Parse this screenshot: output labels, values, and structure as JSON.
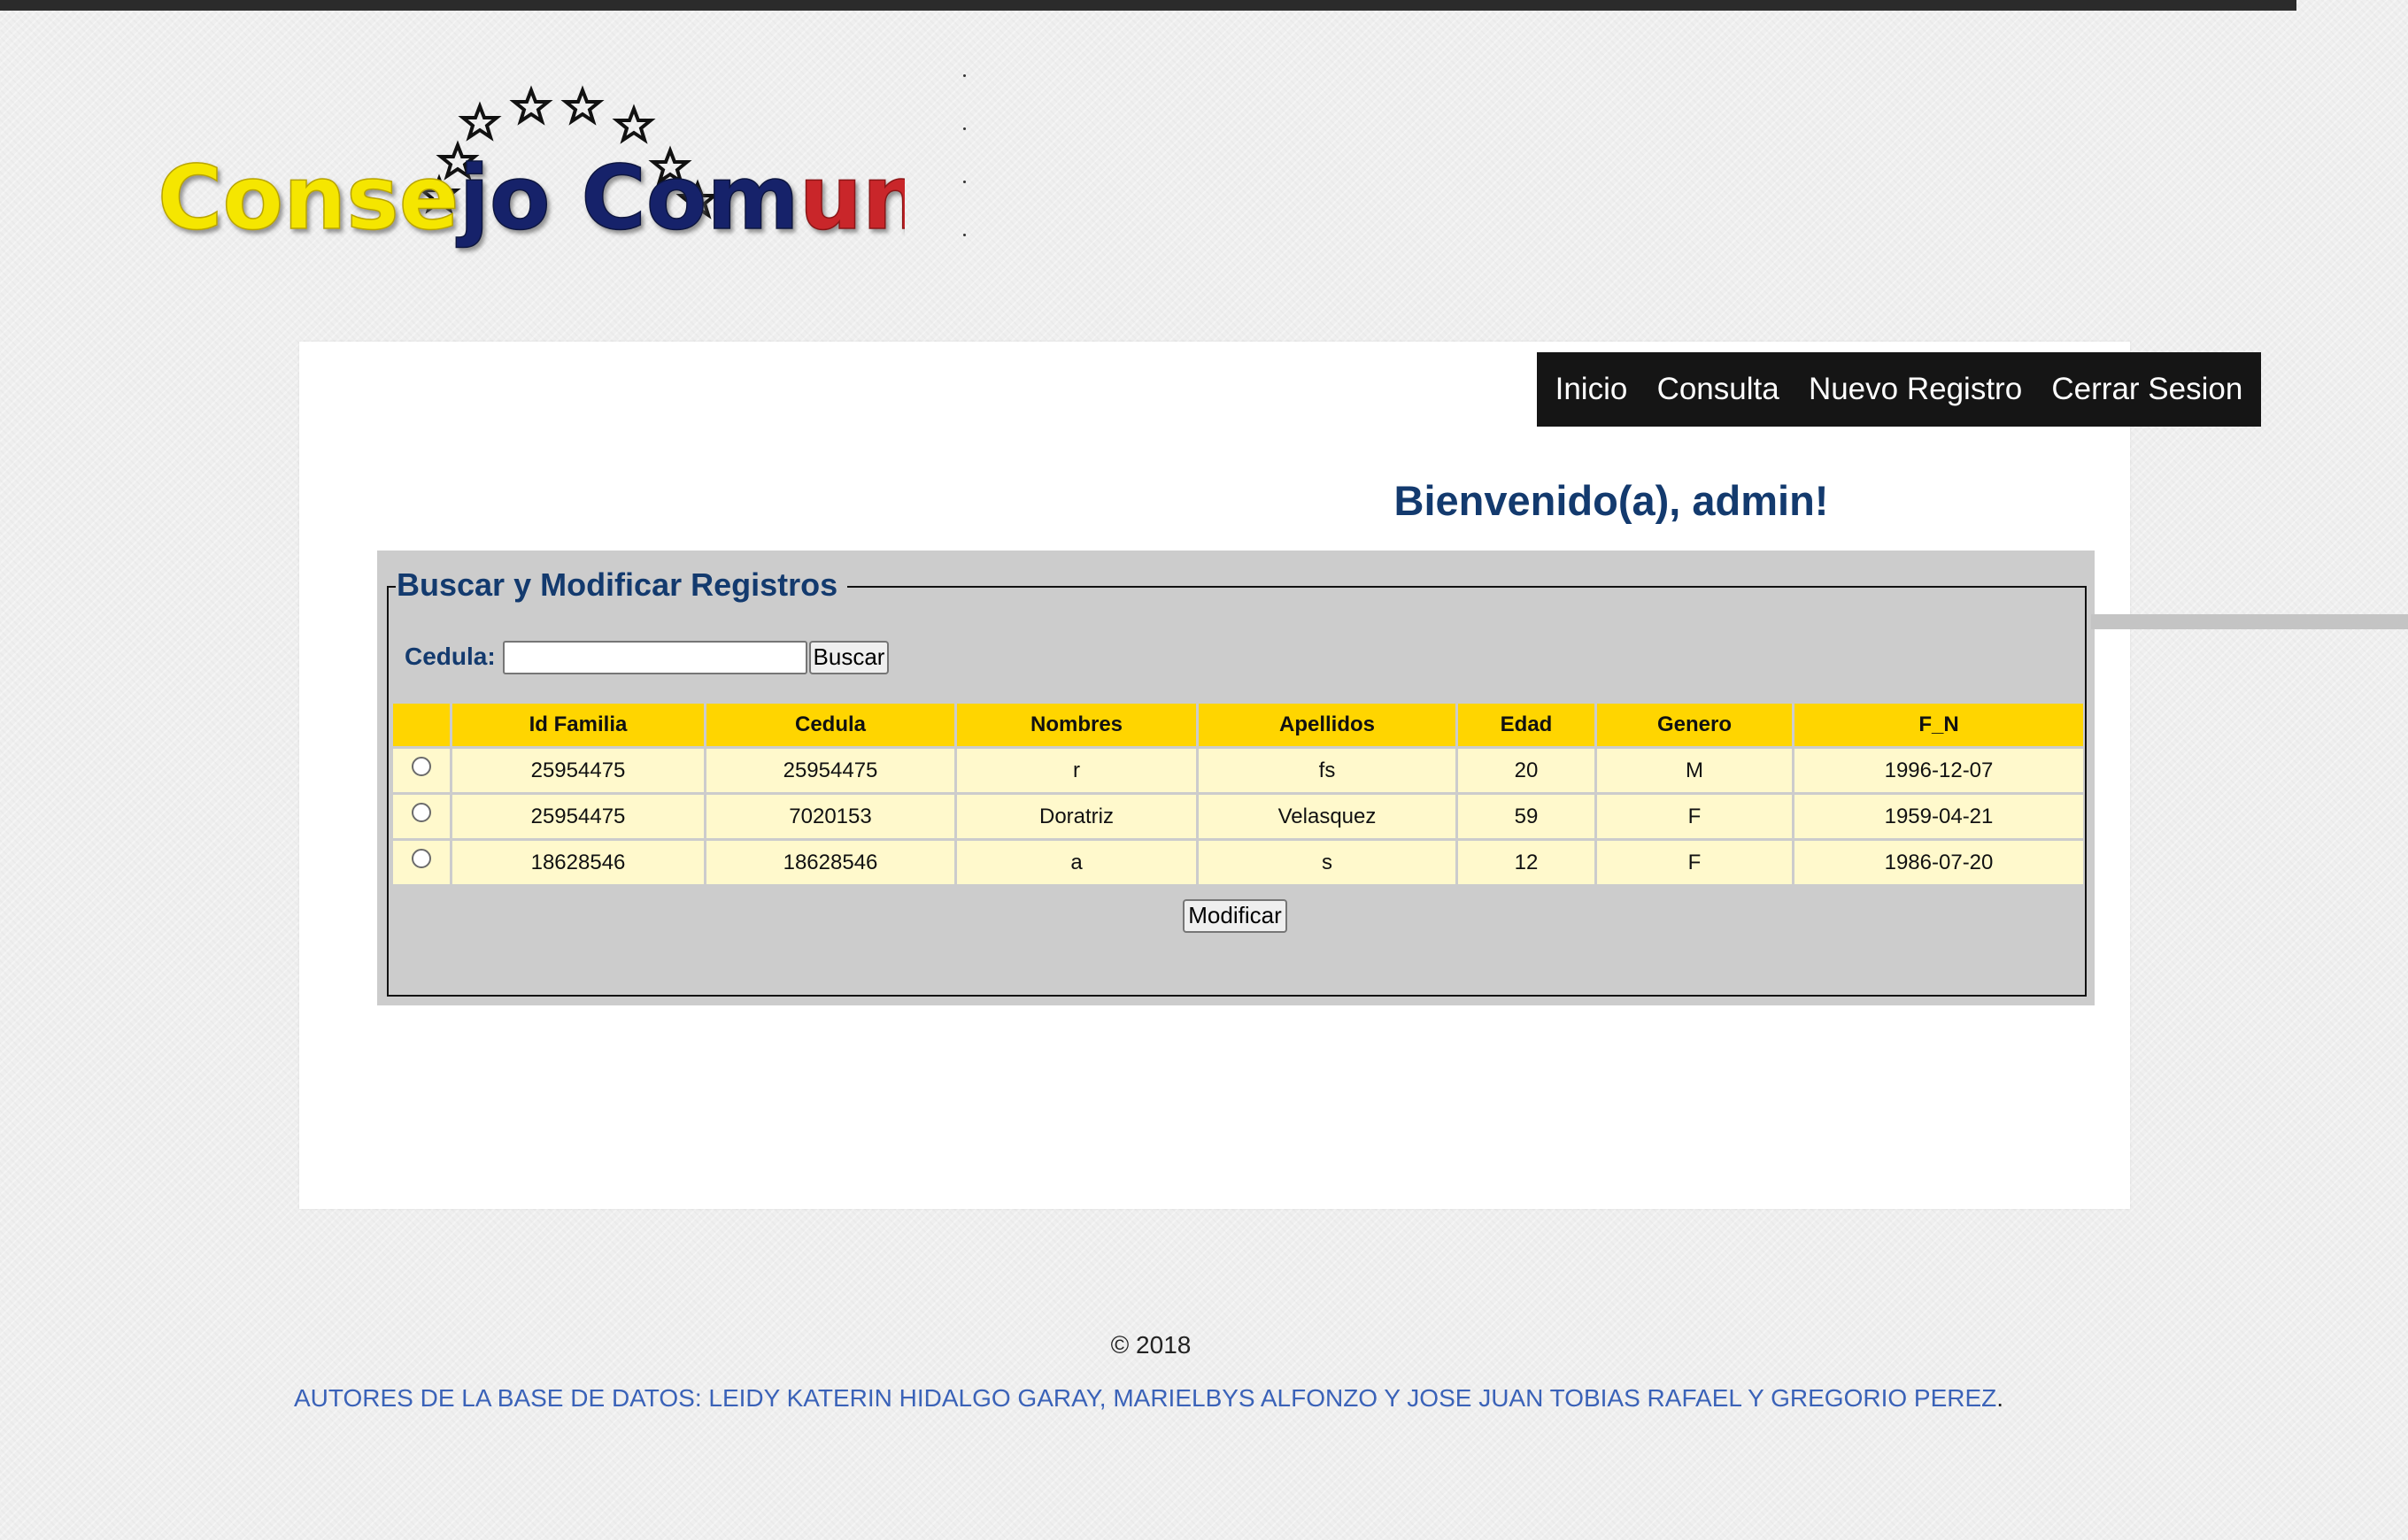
{
  "logo": {
    "text_part1": "Conse",
    "text_part2": "jo Com",
    "text_part3": "unal",
    "colors": {
      "yellow": "#f5e600",
      "blue": "#17246b",
      "red": "#c9262b"
    }
  },
  "nav": {
    "items": [
      "Inicio",
      "Consulta",
      "Nuevo Registro",
      "Cerrar Sesion"
    ]
  },
  "welcome": "Bienvenido(a), admin!",
  "search": {
    "legend": "Buscar y Modificar Registros",
    "cedula_label": "Cedula:",
    "cedula_value": "",
    "search_button": "Buscar",
    "modify_button": "Modificar"
  },
  "table": {
    "headers": [
      "",
      "Id Familia",
      "Cedula",
      "Nombres",
      "Apellidos",
      "Edad",
      "Genero",
      "F_N"
    ],
    "rows": [
      [
        "25954475",
        "25954475",
        "r",
        "fs",
        "20",
        "M",
        "1996-12-07"
      ],
      [
        "25954475",
        "7020153",
        "Doratriz",
        "Velasquez",
        "59",
        "F",
        "1959-04-21"
      ],
      [
        "18628546",
        "18628546",
        "a",
        "s",
        "12",
        "F",
        "1986-07-20"
      ]
    ]
  },
  "footer": {
    "copyright": "© 2018",
    "authors": "AUTORES DE LA BASE DE DATOS: LEIDY KATERIN HIDALGO GARAY, MARIELBYS ALFONZO Y JOSE JUAN TOBIAS RAFAEL Y GREGORIO PEREZ",
    "authors_period": "."
  },
  "colors": {
    "accent_blue": "#133a6e",
    "header_yellow": "#ffd500",
    "row_yellow": "#fff9cc",
    "nav_bg": "#151515",
    "link_blue": "#3a62b8"
  }
}
